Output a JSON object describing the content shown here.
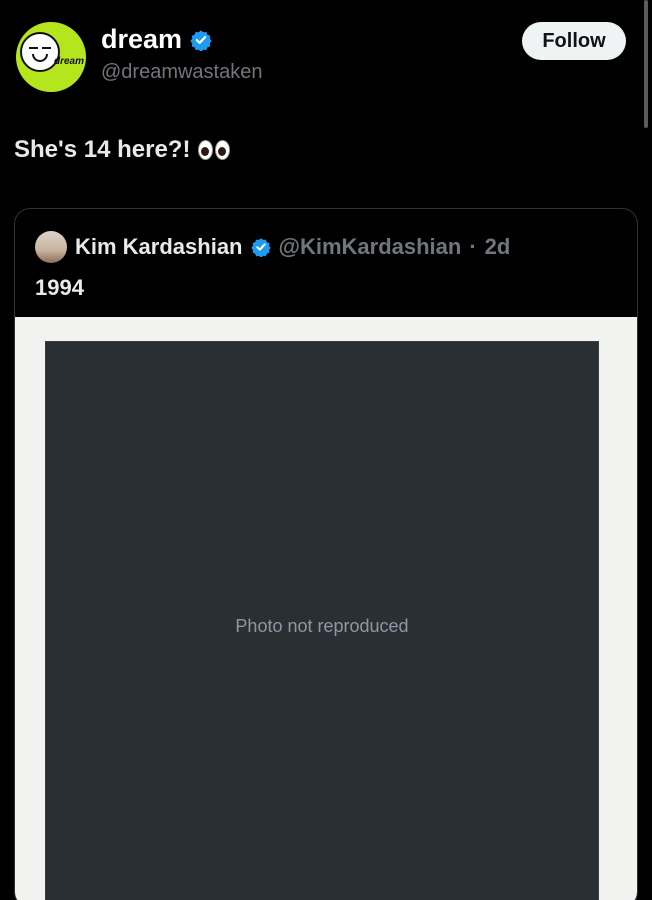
{
  "post": {
    "author": {
      "display_name": "dream",
      "handle": "@dreamwastaken",
      "avatar_text": "dream",
      "verified": true
    },
    "follow_label": "Follow",
    "text": "She's 14 here?!",
    "emoji": "eyes"
  },
  "quoted_post": {
    "author": {
      "display_name": "Kim Kardashian",
      "handle": "@KimKardashian",
      "verified": true
    },
    "time": "2d",
    "text": "1994"
  },
  "colors": {
    "background": "#000000",
    "verified_blue": "#1d9bf0",
    "follow_bg": "#eff3f4",
    "muted_text": "#71767b"
  }
}
